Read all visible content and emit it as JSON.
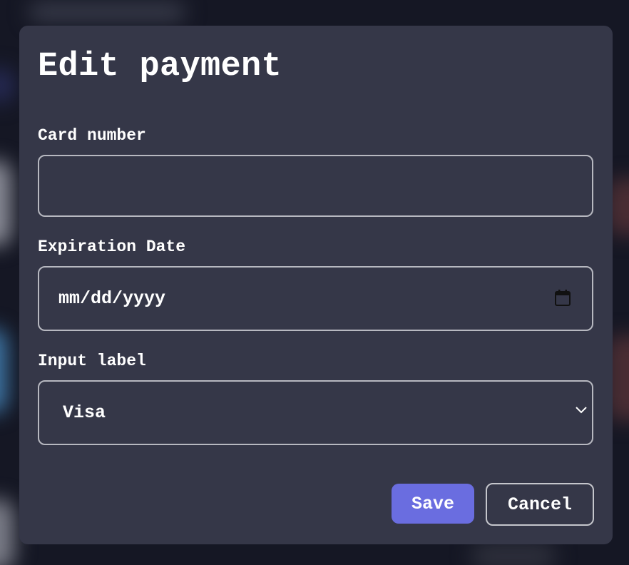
{
  "dialog": {
    "title": "Edit payment",
    "card_number": {
      "label": "Card number",
      "value": "",
      "placeholder": ""
    },
    "expiration_date": {
      "label": "Expiration Date",
      "placeholder": "mm/dd/yyyy",
      "icon": "calendar-icon"
    },
    "card_type": {
      "label": "Input label",
      "selected": "Visa",
      "icon": "chevron-down-icon"
    },
    "buttons": {
      "save_label": "Save",
      "cancel_label": "Cancel"
    }
  },
  "colors": {
    "dialog_background": "#353748",
    "primary_button": "#6a6de0",
    "input_border": "#b7b8c0",
    "text": "#ffffff"
  }
}
